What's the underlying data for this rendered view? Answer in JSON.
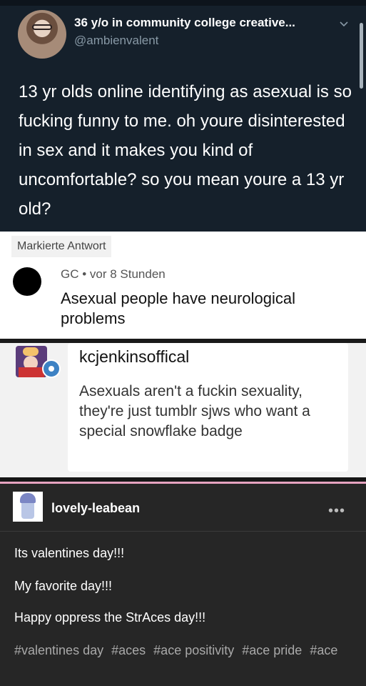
{
  "tweet": {
    "display_name": "36 y/o in community college creative...",
    "handle": "@ambienvalent",
    "text": "13 yr olds online identifying as asexual is so fucking funny to me. oh youre disinterested in sex and it makes you kind of uncomfortable? so you mean youre a 13 yr old?",
    "icons": [
      "avatar",
      "chevron-down-icon",
      "scrollbar"
    ]
  },
  "google_answer": {
    "tag": "Markierte Antwort",
    "meta": "GC • vor 8 Stunden",
    "text": "Asexual people have neurological problems"
  },
  "forum_post": {
    "username": "kcjenkinsoffical",
    "text": "Asexuals aren't a fuckin sexuality, they're just tumblr sjws who want a special snowflake badge"
  },
  "tumblr_post": {
    "username": "lovely-leabean",
    "more": "•••",
    "lines": [
      "Its valentines day!!!",
      "My favorite day!!!",
      "Happy oppress the StrAces day!!!"
    ],
    "tags": [
      "#valentines day",
      "#aces",
      "#ace positivity",
      "#ace pride",
      "#ace"
    ]
  }
}
